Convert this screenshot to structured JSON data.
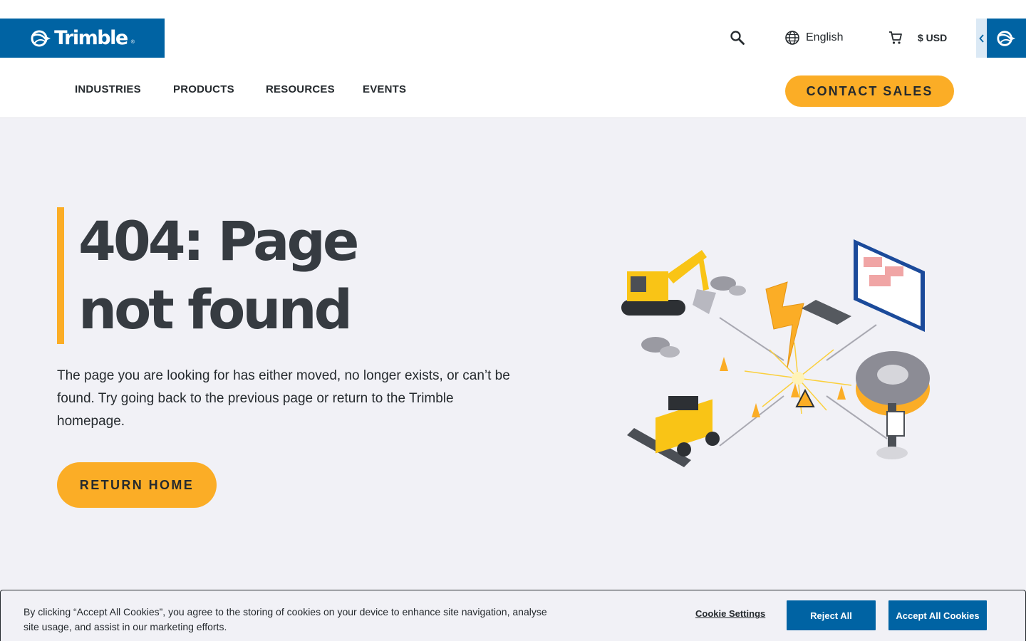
{
  "header": {
    "logo_text": "Trimble",
    "logo_reg": "®",
    "language": "English",
    "currency": "$ USD",
    "icons": [
      "search-icon",
      "globe-icon",
      "cart-icon",
      "chevron-left-icon",
      "trimble-mark-icon"
    ]
  },
  "nav": {
    "items": [
      {
        "label": "INDUSTRIES"
      },
      {
        "label": "PRODUCTS"
      },
      {
        "label": "RESOURCES"
      },
      {
        "label": "EVENTS"
      }
    ],
    "contact_label": "CONTACT SALES"
  },
  "main": {
    "title_line1": "404: Page",
    "title_line2": "not found",
    "description": "The page you are looking for has either moved, no longer exists, or can’t be found. Try going back to the previous page or return to the Trimble homepage.",
    "return_label": "RETURN HOME"
  },
  "cookie": {
    "text": "By clicking “Accept All Cookies”, you agree to the storing of cookies on your device to enhance site navigation, analyse site usage, and assist in our marketing efforts.",
    "settings_label": "Cookie Settings",
    "reject_label": "Reject All",
    "accept_label": "Accept All Cookies"
  },
  "colors": {
    "brand_blue": "#0063a3",
    "accent_yellow": "#fbad26",
    "background": "#f1f1f6",
    "text_dark": "#252a2e"
  }
}
